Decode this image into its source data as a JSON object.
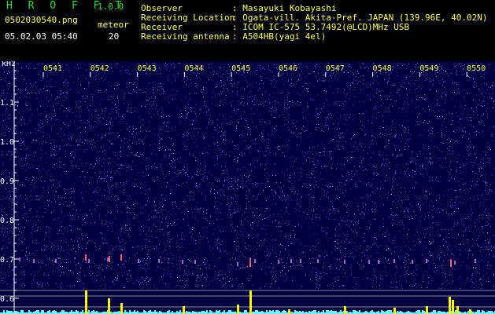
{
  "app": {
    "title": "H R O F F T",
    "version": "1.0.0"
  },
  "file": {
    "name": "0502030540.png",
    "datetime": "05.02.03 05:40"
  },
  "meteor": {
    "label": "meteor",
    "count": "20"
  },
  "info": [
    {
      "key": "Observer",
      "value": ": Masayuki Kobayashi"
    },
    {
      "key": "Receiving Location",
      "value": ": Ogata-vill. Akita-Pref. JAPAN (139.96E, 40.02N)"
    },
    {
      "key": "Receiver",
      "value": ": ICOM IC-575 53.7492(@LCD)MHz USB"
    },
    {
      "key": "Receiving antenna",
      "value": ": A504HB(yagi 4el)"
    }
  ],
  "spectrogram": {
    "y_unit": "kHz",
    "y_ticks": [
      "1.1",
      "1.0",
      "0.9",
      "0.8",
      "0.7",
      "0.6"
    ],
    "time_ticks": [
      "0541",
      "0542",
      "0543",
      "0544",
      "0545",
      "0546",
      "0547",
      "0548",
      "0549",
      "0550"
    ],
    "colors": {
      "background": "#000040",
      "tick_text": "#ffff33",
      "axis_text": "#ffffff",
      "meteor_trace": "#ff3333",
      "signal_bars": "#ffff00",
      "noise_floor": "#66ffff"
    }
  }
}
